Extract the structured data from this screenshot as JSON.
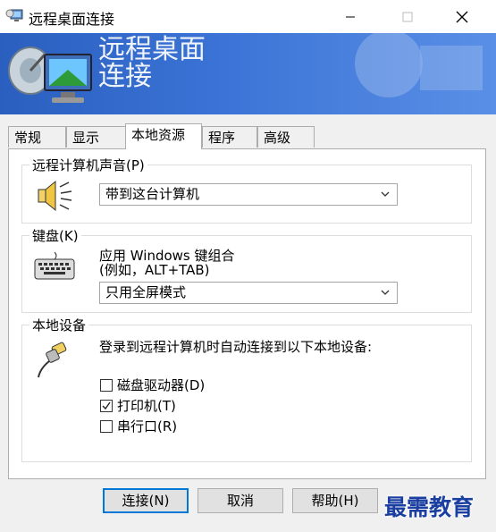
{
  "window": {
    "title": "远程桌面连接"
  },
  "banner": {
    "line1": "远程桌面",
    "line2": "连接"
  },
  "tabs": [
    {
      "label": "常规"
    },
    {
      "label": "显示"
    },
    {
      "label": "本地资源",
      "active": true
    },
    {
      "label": "程序"
    },
    {
      "label": "高级"
    }
  ],
  "sound": {
    "group_label": "远程计算机声音(P)",
    "selected": "带到这台计算机"
  },
  "keyboard": {
    "group_label": "键盘(K)",
    "desc_line1": "应用 Windows 键组合",
    "desc_line2": "(例如，ALT+TAB)",
    "selected": "只用全屏模式"
  },
  "devices": {
    "group_label": "本地设备",
    "desc": "登录到远程计算机时自动连接到以下本地设备:",
    "items": [
      {
        "label": "磁盘驱动器(D)",
        "checked": false
      },
      {
        "label": "打印机(T)",
        "checked": true
      },
      {
        "label": "串行口(R)",
        "checked": false
      }
    ]
  },
  "buttons": {
    "connect": "连接(N)",
    "cancel": "取消",
    "help": "帮助(H)"
  },
  "watermark": "最需教育",
  "colors": {
    "banner": "#3b74d6",
    "accent": "#0078d7"
  }
}
